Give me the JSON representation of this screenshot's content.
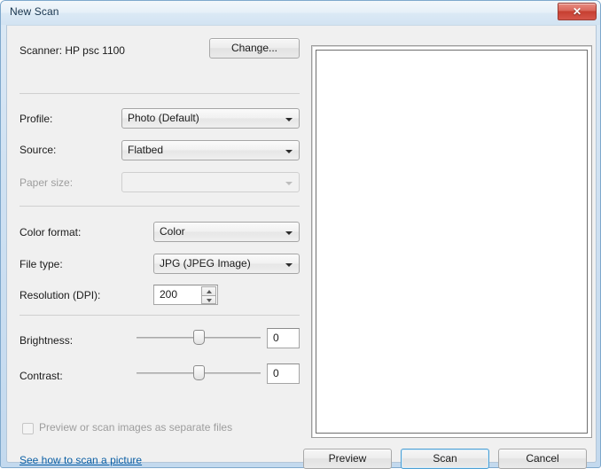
{
  "window": {
    "title": "New Scan",
    "close_icon": "close-icon",
    "close_glyph": "✕"
  },
  "scanner": {
    "label": "Scanner: HP psc 1100",
    "change_button": "Change..."
  },
  "fields": {
    "profile": {
      "label": "Profile:",
      "value": "Photo (Default)",
      "enabled": true
    },
    "source": {
      "label": "Source:",
      "value": "Flatbed",
      "enabled": true
    },
    "paper_size": {
      "label": "Paper size:",
      "value": "",
      "enabled": false
    },
    "color_format": {
      "label": "Color format:",
      "value": "Color",
      "enabled": true
    },
    "file_type": {
      "label": "File type:",
      "value": "JPG (JPEG Image)",
      "enabled": true
    },
    "resolution": {
      "label": "Resolution (DPI):",
      "value": "200",
      "enabled": true
    },
    "brightness": {
      "label": "Brightness:",
      "value": "0",
      "slider_percent": 50
    },
    "contrast": {
      "label": "Contrast:",
      "value": "0",
      "slider_percent": 50
    }
  },
  "separate_files": {
    "label": "Preview or scan images as separate files",
    "checked": false,
    "enabled": false
  },
  "help_link": {
    "text": "See how to scan a picture"
  },
  "actions": {
    "preview": "Preview",
    "scan": "Scan",
    "cancel": "Cancel",
    "default_button": "Scan"
  },
  "preview_pane": {
    "content": ""
  },
  "colors": {
    "accent": "#0b5fa5",
    "titlebar": "#e6f0f8",
    "close_button": "#c63f31",
    "dialog_background": "#f0f0f0",
    "default_button_border": "#4c9fd4"
  }
}
